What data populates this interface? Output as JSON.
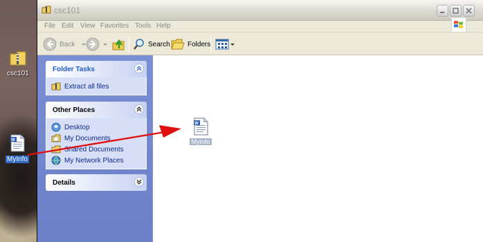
{
  "desktop": {
    "folder_icon_label": "csc101",
    "doc_icon_label": "MyInfo"
  },
  "window": {
    "title": "csc101",
    "menu": [
      "File",
      "Edit",
      "View",
      "Favorites",
      "Tools",
      "Help"
    ],
    "toolbar": {
      "back_label": "Back",
      "search_label": "Search",
      "folders_label": "Folders"
    }
  },
  "taskpane": {
    "folder_tasks": {
      "title": "Folder Tasks",
      "items": [
        "Extract all files"
      ]
    },
    "other_places": {
      "title": "Other Places",
      "items": [
        "Desktop",
        "My Documents",
        "Shared Documents",
        "My Network Places"
      ]
    },
    "details": {
      "title": "Details"
    }
  },
  "content": {
    "file_label": "MyInfo"
  },
  "colors": {
    "taskpane_bg": "#7a8fd4",
    "link": "#0c2a8c",
    "group_title": "#215dc6",
    "selection": "#316ac5",
    "arrow": "#e01010"
  }
}
